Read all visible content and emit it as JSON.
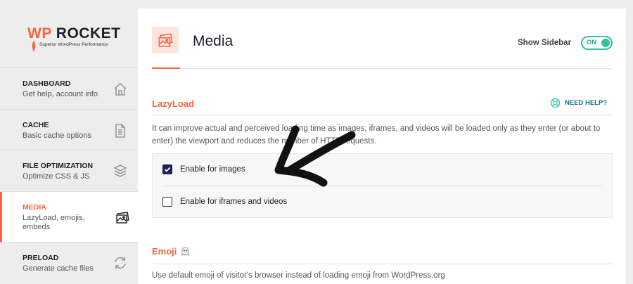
{
  "brand": {
    "logo_wp": "WP",
    "logo_rocket": "ROCKET",
    "tagline": "Superior WordPress Performance",
    "accent": "#f56640"
  },
  "sidebar": {
    "items": [
      {
        "title": "DASHBOARD",
        "subtitle": "Get help, account info",
        "icon": "home-icon"
      },
      {
        "title": "CACHE",
        "subtitle": "Basic cache options",
        "icon": "file-icon"
      },
      {
        "title": "FILE OPTIMIZATION",
        "subtitle": "Optimize CSS & JS",
        "icon": "layers-icon"
      },
      {
        "title": "MEDIA",
        "subtitle": "LazyLoad, emojis, embeds",
        "icon": "images-icon"
      },
      {
        "title": "PRELOAD",
        "subtitle": "Generate cache files",
        "icon": "refresh-icon"
      }
    ],
    "active_index": 3
  },
  "header": {
    "title": "Media",
    "show_sidebar_label": "Show Sidebar",
    "toggle_state": "ON",
    "toggle_color": "#2ec4a3"
  },
  "lazyload": {
    "title": "LazyLoad",
    "need_help": "NEED HELP?",
    "description": "It can improve actual and perceived loading time as images, iframes, and videos will be loaded only as they enter (or about to enter) the viewport and reduces the number of HTTP requests.",
    "options": [
      {
        "label": "Enable for images",
        "checked": true
      },
      {
        "label": "Enable for iframes and videos",
        "checked": false
      }
    ]
  },
  "emoji": {
    "title": "Emoji",
    "description": "Use default emoji of visitor's browser instead of loading emoji from WordPress.org"
  }
}
